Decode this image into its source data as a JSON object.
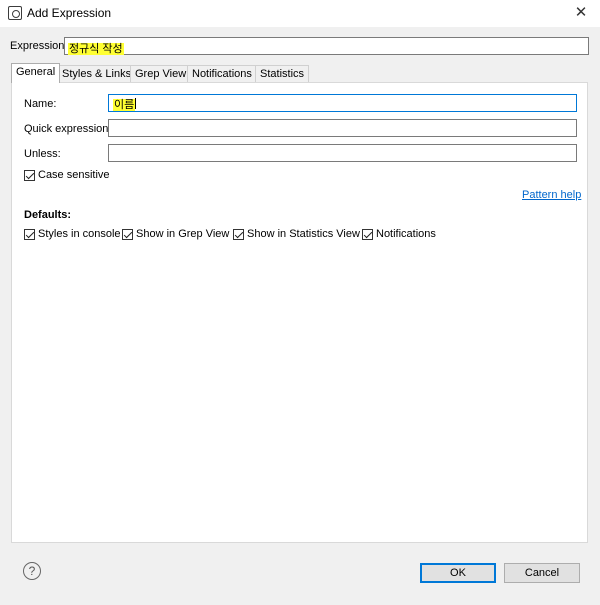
{
  "window": {
    "title": "Add Expression",
    "icon": "app-icon",
    "close_icon": "close-icon",
    "close_glyph": "✕"
  },
  "expression": {
    "label": "Expression:",
    "value": "정규식 작성",
    "highlight_color": "#ffff33"
  },
  "tabs": [
    {
      "label": "General",
      "active": true
    },
    {
      "label": "Styles & Links",
      "active": false
    },
    {
      "label": "Grep View",
      "active": false
    },
    {
      "label": "Notifications",
      "active": false
    },
    {
      "label": "Statistics",
      "active": false
    }
  ],
  "general": {
    "name_label": "Name:",
    "name_value": "이름",
    "quick_label": "Quick expression:",
    "quick_value": "",
    "unless_label": "Unless:",
    "unless_value": "",
    "case_sensitive_label": "Case sensitive",
    "case_sensitive_checked": true,
    "pattern_help": "Pattern help",
    "defaults_label": "Defaults:",
    "defaults": [
      {
        "label": "Styles in console",
        "checked": true
      },
      {
        "label": "Show in Grep View",
        "checked": true
      },
      {
        "label": "Show in Statistics View",
        "checked": true
      },
      {
        "label": "Notifications",
        "checked": true
      }
    ]
  },
  "footer": {
    "help_icon": "help-icon",
    "help_glyph": "?",
    "ok_label": "OK",
    "cancel_label": "Cancel"
  },
  "colors": {
    "focus_border": "#0078d7",
    "link": "#0066cc"
  }
}
